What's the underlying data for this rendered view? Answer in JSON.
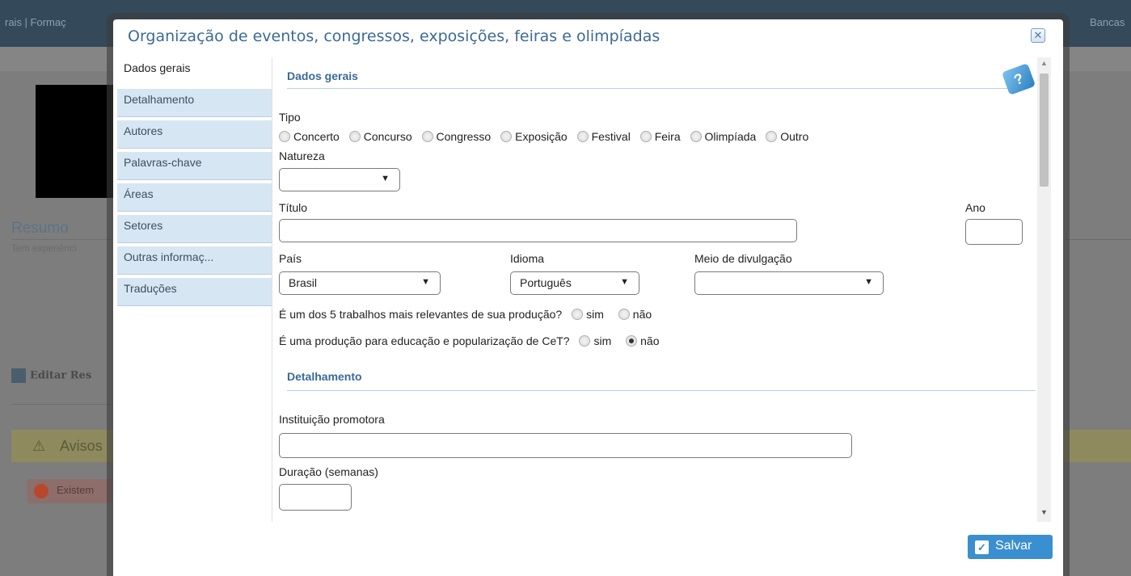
{
  "background": {
    "topbar_left": "rais  |  Formaç",
    "topbar_right": "Bancas",
    "resumo": "Resumo",
    "experiencia": "Tem experiênci",
    "edit": "Editar Res",
    "avisos": "Avisos",
    "existem": "Existem"
  },
  "modal": {
    "title": "Organização de eventos, congressos, exposições, feiras e olimpíadas",
    "close_icon": "close-icon",
    "help_icon": "help-book-icon",
    "save_label": "Salvar"
  },
  "tabs": [
    {
      "label": "Dados gerais"
    },
    {
      "label": "Detalhamento"
    },
    {
      "label": "Autores"
    },
    {
      "label": "Palavras-chave"
    },
    {
      "label": "Áreas"
    },
    {
      "label": "Setores"
    },
    {
      "label": "Outras informaç..."
    },
    {
      "label": "Traduções"
    }
  ],
  "form": {
    "section_general": "Dados gerais",
    "tipo_label": "Tipo",
    "tipo_options": [
      "Concerto",
      "Concurso",
      "Congresso",
      "Exposição",
      "Festival",
      "Feira",
      "Olimpíada",
      "Outro"
    ],
    "natureza_label": "Natureza",
    "natureza_value": "",
    "titulo_label": "Título",
    "titulo_value": "",
    "ano_label": "Ano",
    "ano_value": "",
    "pais_label": "País",
    "pais_value": "Brasil",
    "idioma_label": "Idioma",
    "idioma_value": "Português",
    "meio_label": "Meio de divulgação",
    "meio_value": "",
    "relevante_question": "É um dos 5 trabalhos mais relevantes de sua produção?",
    "educacao_question": "É uma produção para educação e popularização de CeT?",
    "sim": "sim",
    "nao": "não",
    "section_detail": "Detalhamento",
    "instituicao_label": "Instituição promotora",
    "instituicao_value": "",
    "duracao_label": "Duração (semanas)",
    "duracao_value": ""
  }
}
